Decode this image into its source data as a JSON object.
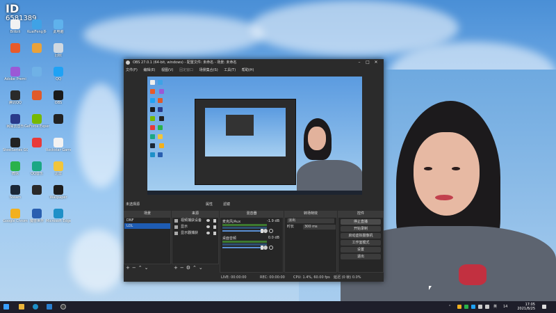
{
  "overlay": {
    "label": "ID",
    "number": "6581389"
  },
  "desktop_icons": [
    {
      "label": "Bilibili",
      "color": "#f2f2f2"
    },
    {
      "label": "KuaiFeng多",
      "color": "#3fa2e6"
    },
    {
      "label": "此电脑",
      "color": "#5fb2ec"
    },
    {
      "label": "",
      "color": "#e85a2a"
    },
    {
      "label": "",
      "color": "#e9a23b"
    },
    {
      "label": "回收",
      "color": "#d0d8e0"
    },
    {
      "label": "Adobe Premi",
      "color": "#9b59d6"
    },
    {
      "label": "",
      "color": "#6fb1e6"
    },
    {
      "label": "QQ",
      "color": "#1fa2f5"
    },
    {
      "label": "腾讯QQ",
      "color": "#2a2a2a"
    },
    {
      "label": "",
      "color": "#e05a2a"
    },
    {
      "label": "OBS",
      "color": "#1a1a1a"
    },
    {
      "label": "网易云音乐",
      "color": "#2a3a8a"
    },
    {
      "label": "GeForce Experience",
      "color": "#76b900"
    },
    {
      "label": "",
      "color": "#222"
    },
    {
      "label": "SteelSeries GG",
      "color": "#222"
    },
    {
      "label": "",
      "color": "#e83a3a"
    },
    {
      "label": "Rockstar Games",
      "color": "#f2f2f2"
    },
    {
      "label": "微信",
      "color": "#2ab24a"
    },
    {
      "label": "QQ音乐",
      "color": "#1ba784"
    },
    {
      "label": "迅雷",
      "color": "#f2c53b"
    },
    {
      "label": "Steam",
      "color": "#1b2838"
    },
    {
      "label": "",
      "color": "#2a2a2a"
    },
    {
      "label": "Wallpaper",
      "color": "#1e1e1e"
    },
    {
      "label": "Google Chrome",
      "color": "#f2b01e"
    },
    {
      "label": "魔兽世界",
      "color": "#2a5fb0"
    },
    {
      "label": "Microsoft Edge",
      "color": "#1e90c8"
    }
  ],
  "obs": {
    "title": "OBS 27.0.1 (64-bit, windows) - 配置文件: 未命名 - 场景: 未命名",
    "menu": [
      "文件(F)",
      "编辑(E)",
      "视图(V)",
      "固定窗口",
      "场景集合(S)",
      "工具(T)",
      "帮助(H)"
    ],
    "source_bar_label": "未选择源",
    "source_bar_buttons": [
      "属性",
      "滤镜"
    ],
    "panes": {
      "scenes_title": "场景",
      "sources_title": "来源",
      "mixer_title": "混音器",
      "transitions_title": "转场特效",
      "controls_title": "控件"
    },
    "scenes": [
      "DNF",
      "LOL"
    ],
    "active_scene_index": 1,
    "sources": [
      "视频捕获设备",
      "显示",
      "显示器捕获"
    ],
    "mixer": [
      {
        "name": "麦克风/Aux",
        "db": "-1.9 dB"
      },
      {
        "name": "桌面音频",
        "db": "0.0 dB"
      }
    ],
    "transitions": {
      "type_label": "淡出",
      "duration_label": "时长",
      "duration_value": "300 ms"
    },
    "controls": [
      "停止直播",
      "开始录制",
      "启动虚拟摄像机",
      "工作室模式",
      "设置",
      "退出"
    ],
    "status": {
      "live": "LIVE: 00:00:00",
      "rec": "REC: 00:00:00",
      "cpu": "CPU: 1.4%, 60.00 fps",
      "dropped": "延迟 (0 帧) 0.0%"
    }
  },
  "taskbar": {
    "time": "17:05",
    "date": "2021/8/25",
    "lang": "英",
    "badge": "14"
  }
}
